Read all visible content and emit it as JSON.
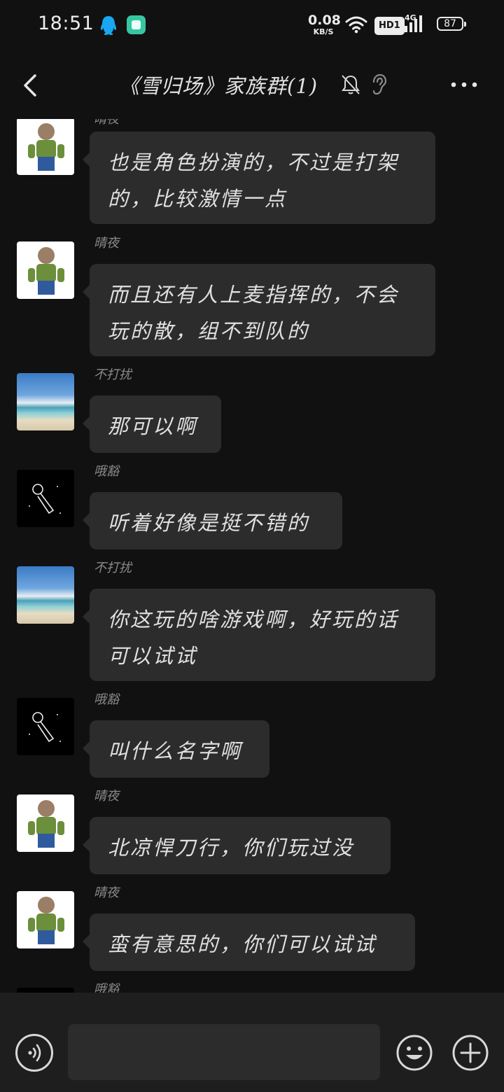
{
  "status_bar": {
    "time": "18:51",
    "net_speed_value": "0.08",
    "net_speed_unit": "KB/S",
    "hd_label": "HD1",
    "network_label": "4G",
    "battery": "87"
  },
  "header": {
    "title": "《雪归场》家族群(1)",
    "back_icon": "chevron-left-icon",
    "mute_icon": "bell-off-icon",
    "ear_icon": "ear-icon",
    "more_icon": "more-horizontal-icon"
  },
  "messages": [
    {
      "sender": "晴夜",
      "avatar": "man",
      "text": "也是角色扮演的，不过是打架的，比较激情一点"
    },
    {
      "sender": "晴夜",
      "avatar": "man",
      "text": "而且还有人上麦指挥的，不会玩的散，组不到队的"
    },
    {
      "sender": "不打扰",
      "avatar": "sea",
      "text": "那可以啊"
    },
    {
      "sender": "哦豁",
      "avatar": "astronaut",
      "text": "听着好像是挺不错的"
    },
    {
      "sender": "不打扰",
      "avatar": "sea",
      "text": "你这玩的啥游戏啊，好玩的话可以试试"
    },
    {
      "sender": "哦豁",
      "avatar": "astronaut",
      "text": "叫什么名字啊"
    },
    {
      "sender": "晴夜",
      "avatar": "man",
      "text": "北凉悍刀行，你们玩过没"
    },
    {
      "sender": "晴夜",
      "avatar": "man",
      "text": "蛮有意思的，你们可以试试"
    },
    {
      "sender": "哦豁",
      "avatar": "astronaut",
      "text": ""
    }
  ],
  "input_bar": {
    "placeholder": "",
    "voice_icon": "voice-icon",
    "emoji_icon": "smile-icon",
    "plus_icon": "plus-icon"
  },
  "colors": {
    "background": "#111111",
    "bubble": "#2c2c2c",
    "input_bar": "#1e1e1e",
    "text": "#e0e0e0",
    "sender": "#8a8a8a"
  }
}
